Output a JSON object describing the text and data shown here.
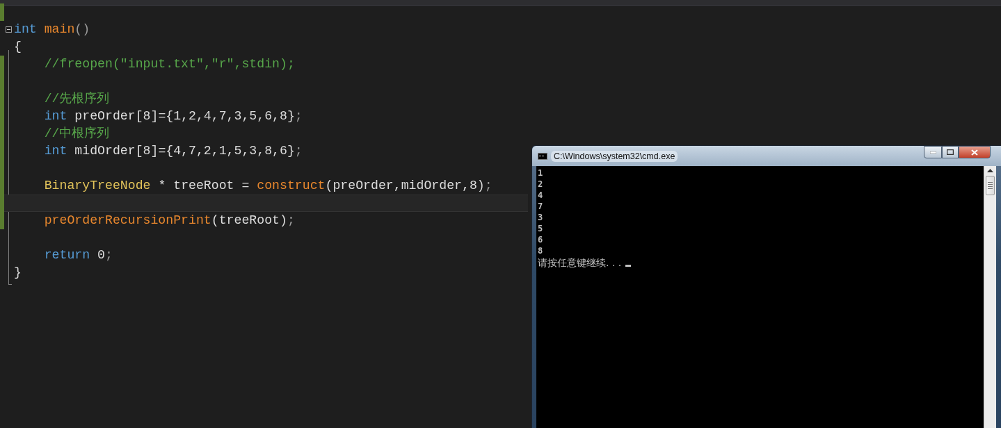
{
  "editor": {
    "lines": [
      {
        "modified": true,
        "current": false
      },
      {
        "modified": false,
        "current": false,
        "fold": {
          "expanded": true
        },
        "tokens": [
          {
            "kind": "keyword",
            "text": "int"
          },
          {
            "kind": "function",
            "text": " main"
          },
          {
            "kind": "punct",
            "text": "()"
          }
        ]
      },
      {
        "modified": false,
        "current": false,
        "tokens": [
          {
            "kind": "plain",
            "text": "{"
          }
        ]
      },
      {
        "modified": true,
        "current": false,
        "tokens": [
          {
            "kind": "comment",
            "text": "    //freopen(\"input.txt\",\"r\",stdin);"
          }
        ]
      },
      {
        "modified": true,
        "current": false
      },
      {
        "modified": true,
        "current": false,
        "tokens": [
          {
            "kind": "comment",
            "text": "    //先根序列"
          }
        ]
      },
      {
        "modified": true,
        "current": false,
        "tokens": [
          {
            "kind": "keyword",
            "text": "    int"
          },
          {
            "kind": "plain",
            "text": " preOrder[8]={1,2,4,7,3,5,6,8}"
          },
          {
            "kind": "punct",
            "text": ";"
          }
        ]
      },
      {
        "modified": true,
        "current": false,
        "tokens": [
          {
            "kind": "comment",
            "text": "    //中根序列"
          }
        ]
      },
      {
        "modified": true,
        "current": false,
        "tokens": [
          {
            "kind": "keyword",
            "text": "    int"
          },
          {
            "kind": "plain",
            "text": " midOrder[8]={4,7,2,1,5,3,8,6}"
          },
          {
            "kind": "punct",
            "text": ";"
          }
        ]
      },
      {
        "modified": true,
        "current": false
      },
      {
        "modified": true,
        "current": false,
        "tokens": [
          {
            "kind": "type",
            "text": "    BinaryTreeNode"
          },
          {
            "kind": "plain",
            "text": " * treeRoot = "
          },
          {
            "kind": "function",
            "text": "construct"
          },
          {
            "kind": "plain",
            "text": "(preOrder,midOrder,8)"
          },
          {
            "kind": "punct",
            "text": ";"
          }
        ]
      },
      {
        "modified": true,
        "current": true
      },
      {
        "modified": true,
        "current": false,
        "tokens": [
          {
            "kind": "function",
            "text": "    preOrderRecursionPrint"
          },
          {
            "kind": "plain",
            "text": "(treeRoot)"
          },
          {
            "kind": "punct",
            "text": ";"
          }
        ]
      },
      {
        "modified": false,
        "current": false
      },
      {
        "modified": false,
        "current": false,
        "tokens": [
          {
            "kind": "keyword",
            "text": "    return"
          },
          {
            "kind": "plain",
            "text": " 0"
          },
          {
            "kind": "punct",
            "text": ";"
          }
        ]
      },
      {
        "modified": false,
        "current": false,
        "tokens": [
          {
            "kind": "plain",
            "text": "}"
          }
        ]
      }
    ]
  },
  "console": {
    "title": "C:\\Windows\\system32\\cmd.exe",
    "output": [
      "1",
      "2",
      "4",
      "7",
      "3",
      "5",
      "6",
      "8"
    ],
    "prompt": "请按任意键继续. . ."
  }
}
